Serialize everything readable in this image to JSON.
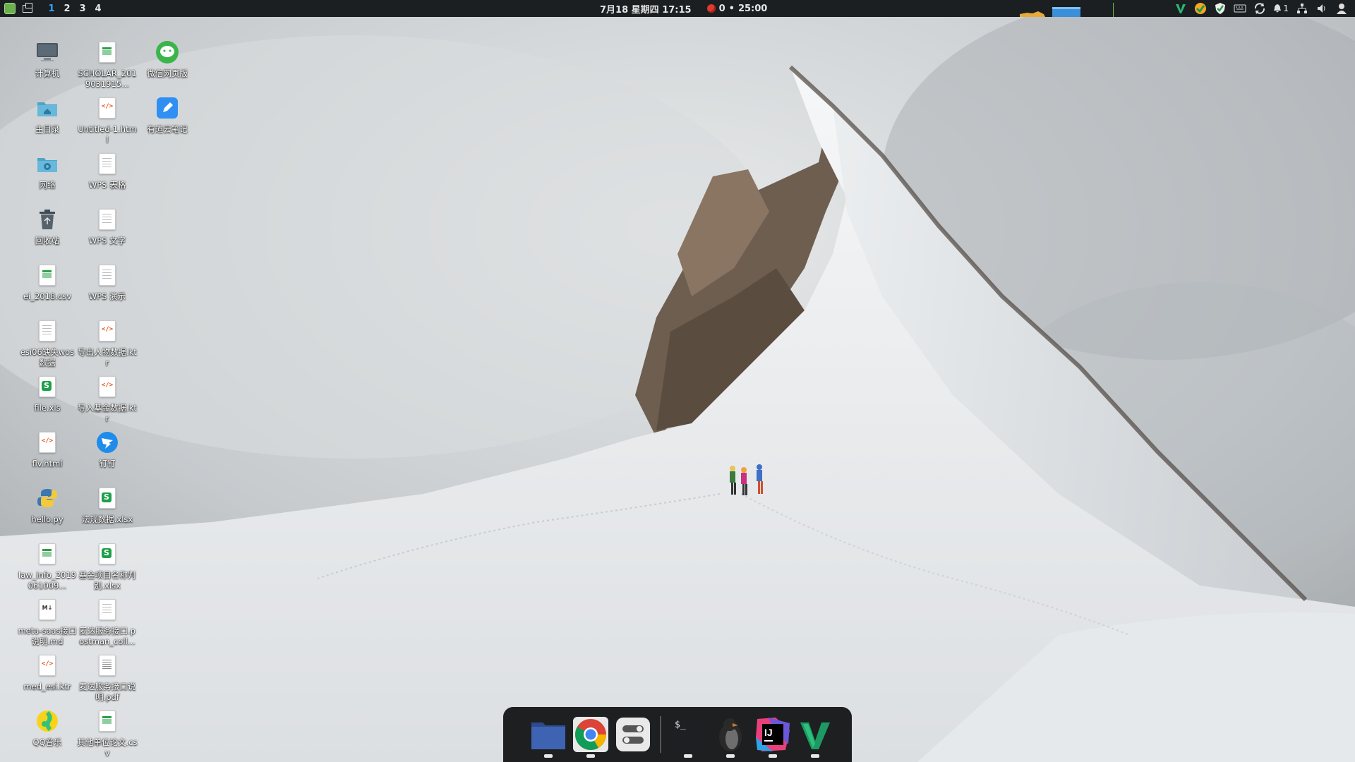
{
  "top_panel": {
    "workspaces": [
      "1",
      "2",
      "3",
      "4"
    ],
    "active_workspace": "1",
    "datetime": "7月18 星期四 17:15",
    "pomodoro_count": "0",
    "pomodoro_sep": "•",
    "pomodoro_time": "25:00",
    "notification_count": "1",
    "tray_icons": [
      "vim-icon",
      "qq-icon",
      "shield-icon",
      "keyboard-icon",
      "sync-icon",
      "notification-icon",
      "network-icon",
      "volume-icon",
      "user-icon"
    ]
  },
  "desktop_icons": [
    {
      "label": "计算机",
      "icon": "computer-icon"
    },
    {
      "label": "SCHOLAR_2019031915...",
      "icon": "spreadsheet-icon"
    },
    {
      "label": "微信网页版",
      "icon": "wechat-icon"
    },
    {
      "label": "主目录",
      "icon": "home-folder-icon"
    },
    {
      "label": "Untitled-1.html",
      "icon": "html-file-icon"
    },
    {
      "label": "有道云笔记",
      "icon": "youdao-note-icon"
    },
    {
      "label": "网络",
      "icon": "network-folder-icon"
    },
    {
      "label": "WPS 表格",
      "icon": "document-icon"
    },
    {
      "label": "回收站",
      "icon": "trash-icon"
    },
    {
      "label": "WPS 文字",
      "icon": "document-icon"
    },
    {
      "label": "ei_2018.csv",
      "icon": "spreadsheet-icon"
    },
    {
      "label": "WPS 演示",
      "icon": "document-icon"
    },
    {
      "label": "esi06缺失wos数据",
      "icon": "document-icon"
    },
    {
      "label": "导出人物数据.ktr",
      "icon": "code-file-icon"
    },
    {
      "label": "file.xls",
      "icon": "xls-icon"
    },
    {
      "label": "导入基金数据.ktr",
      "icon": "code-file-icon"
    },
    {
      "label": "flv.html",
      "icon": "html-file-icon"
    },
    {
      "label": "钉钉",
      "icon": "dingtalk-icon"
    },
    {
      "label": "hello.py",
      "icon": "python-icon"
    },
    {
      "label": "法规数据.xlsx",
      "icon": "xls-icon"
    },
    {
      "label": "law_info_2019061009...",
      "icon": "spreadsheet-icon"
    },
    {
      "label": "基金项目名称判别.xlsx",
      "icon": "xls-icon"
    },
    {
      "label": "meta-saas接口说明.md",
      "icon": "markdown-icon"
    },
    {
      "label": "麦达服务接口.postman_coll...",
      "icon": "document-icon"
    },
    {
      "label": "med_esi.ktr",
      "icon": "code-file-icon"
    },
    {
      "label": "麦达服务接口说明.pdf",
      "icon": "pdf-icon"
    },
    {
      "label": "QQ音乐",
      "icon": "qq-music-icon"
    },
    {
      "label": "其他单位论文.csv",
      "icon": "spreadsheet-icon"
    }
  ],
  "dock_items": [
    {
      "name": "file-manager-icon"
    },
    {
      "name": "chrome-icon"
    },
    {
      "name": "settings-toggle-icon"
    },
    {
      "name": "terminal-icon"
    },
    {
      "name": "penguin-app-icon"
    },
    {
      "name": "intellij-idea-icon"
    },
    {
      "name": "vim-icon"
    }
  ],
  "dock_labels": {
    "terminal": "$_",
    "intellij": "IJ"
  },
  "colors": {
    "accent": "#2ea8ff",
    "panel": "#1b1f22",
    "dock": "#0c0e10"
  }
}
